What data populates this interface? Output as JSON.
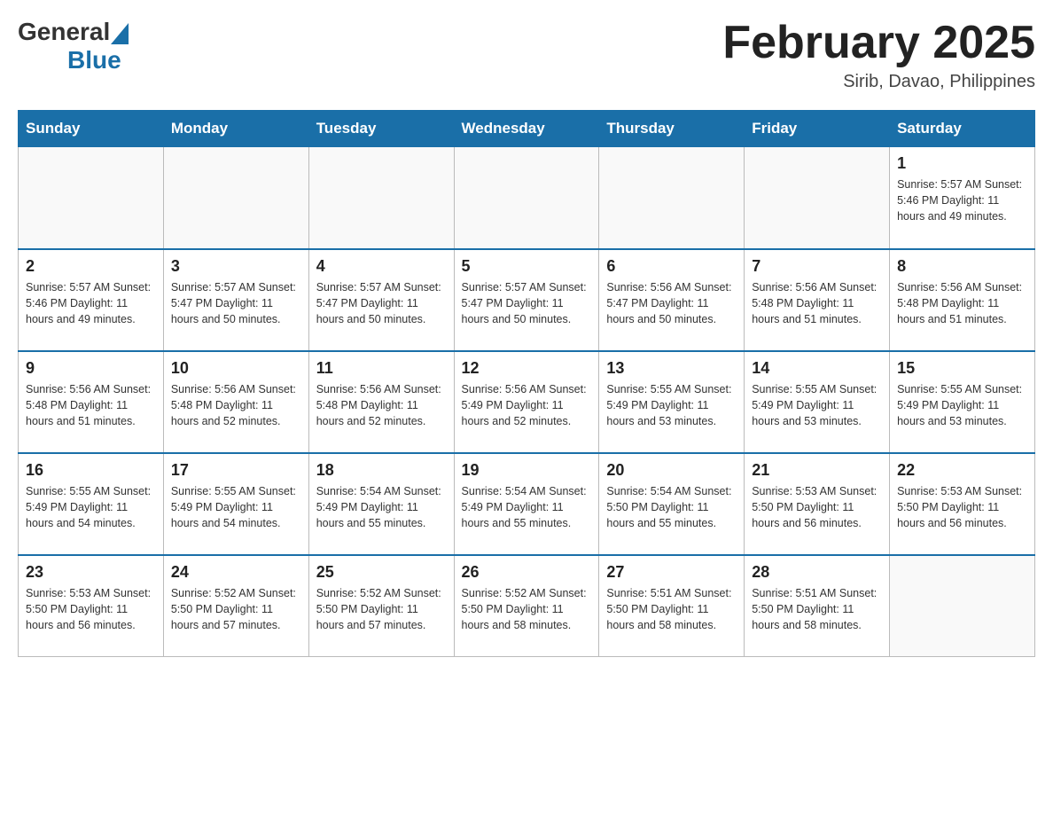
{
  "header": {
    "title": "February 2025",
    "location": "Sirib, Davao, Philippines",
    "logo": {
      "general": "General",
      "blue": "Blue"
    }
  },
  "days_of_week": [
    "Sunday",
    "Monday",
    "Tuesday",
    "Wednesday",
    "Thursday",
    "Friday",
    "Saturday"
  ],
  "weeks": [
    {
      "cells": [
        {
          "day": "",
          "info": ""
        },
        {
          "day": "",
          "info": ""
        },
        {
          "day": "",
          "info": ""
        },
        {
          "day": "",
          "info": ""
        },
        {
          "day": "",
          "info": ""
        },
        {
          "day": "",
          "info": ""
        },
        {
          "day": "1",
          "info": "Sunrise: 5:57 AM\nSunset: 5:46 PM\nDaylight: 11 hours\nand 49 minutes."
        }
      ]
    },
    {
      "cells": [
        {
          "day": "2",
          "info": "Sunrise: 5:57 AM\nSunset: 5:46 PM\nDaylight: 11 hours\nand 49 minutes."
        },
        {
          "day": "3",
          "info": "Sunrise: 5:57 AM\nSunset: 5:47 PM\nDaylight: 11 hours\nand 50 minutes."
        },
        {
          "day": "4",
          "info": "Sunrise: 5:57 AM\nSunset: 5:47 PM\nDaylight: 11 hours\nand 50 minutes."
        },
        {
          "day": "5",
          "info": "Sunrise: 5:57 AM\nSunset: 5:47 PM\nDaylight: 11 hours\nand 50 minutes."
        },
        {
          "day": "6",
          "info": "Sunrise: 5:56 AM\nSunset: 5:47 PM\nDaylight: 11 hours\nand 50 minutes."
        },
        {
          "day": "7",
          "info": "Sunrise: 5:56 AM\nSunset: 5:48 PM\nDaylight: 11 hours\nand 51 minutes."
        },
        {
          "day": "8",
          "info": "Sunrise: 5:56 AM\nSunset: 5:48 PM\nDaylight: 11 hours\nand 51 minutes."
        }
      ]
    },
    {
      "cells": [
        {
          "day": "9",
          "info": "Sunrise: 5:56 AM\nSunset: 5:48 PM\nDaylight: 11 hours\nand 51 minutes."
        },
        {
          "day": "10",
          "info": "Sunrise: 5:56 AM\nSunset: 5:48 PM\nDaylight: 11 hours\nand 52 minutes."
        },
        {
          "day": "11",
          "info": "Sunrise: 5:56 AM\nSunset: 5:48 PM\nDaylight: 11 hours\nand 52 minutes."
        },
        {
          "day": "12",
          "info": "Sunrise: 5:56 AM\nSunset: 5:49 PM\nDaylight: 11 hours\nand 52 minutes."
        },
        {
          "day": "13",
          "info": "Sunrise: 5:55 AM\nSunset: 5:49 PM\nDaylight: 11 hours\nand 53 minutes."
        },
        {
          "day": "14",
          "info": "Sunrise: 5:55 AM\nSunset: 5:49 PM\nDaylight: 11 hours\nand 53 minutes."
        },
        {
          "day": "15",
          "info": "Sunrise: 5:55 AM\nSunset: 5:49 PM\nDaylight: 11 hours\nand 53 minutes."
        }
      ]
    },
    {
      "cells": [
        {
          "day": "16",
          "info": "Sunrise: 5:55 AM\nSunset: 5:49 PM\nDaylight: 11 hours\nand 54 minutes."
        },
        {
          "day": "17",
          "info": "Sunrise: 5:55 AM\nSunset: 5:49 PM\nDaylight: 11 hours\nand 54 minutes."
        },
        {
          "day": "18",
          "info": "Sunrise: 5:54 AM\nSunset: 5:49 PM\nDaylight: 11 hours\nand 55 minutes."
        },
        {
          "day": "19",
          "info": "Sunrise: 5:54 AM\nSunset: 5:49 PM\nDaylight: 11 hours\nand 55 minutes."
        },
        {
          "day": "20",
          "info": "Sunrise: 5:54 AM\nSunset: 5:50 PM\nDaylight: 11 hours\nand 55 minutes."
        },
        {
          "day": "21",
          "info": "Sunrise: 5:53 AM\nSunset: 5:50 PM\nDaylight: 11 hours\nand 56 minutes."
        },
        {
          "day": "22",
          "info": "Sunrise: 5:53 AM\nSunset: 5:50 PM\nDaylight: 11 hours\nand 56 minutes."
        }
      ]
    },
    {
      "cells": [
        {
          "day": "23",
          "info": "Sunrise: 5:53 AM\nSunset: 5:50 PM\nDaylight: 11 hours\nand 56 minutes."
        },
        {
          "day": "24",
          "info": "Sunrise: 5:52 AM\nSunset: 5:50 PM\nDaylight: 11 hours\nand 57 minutes."
        },
        {
          "day": "25",
          "info": "Sunrise: 5:52 AM\nSunset: 5:50 PM\nDaylight: 11 hours\nand 57 minutes."
        },
        {
          "day": "26",
          "info": "Sunrise: 5:52 AM\nSunset: 5:50 PM\nDaylight: 11 hours\nand 58 minutes."
        },
        {
          "day": "27",
          "info": "Sunrise: 5:51 AM\nSunset: 5:50 PM\nDaylight: 11 hours\nand 58 minutes."
        },
        {
          "day": "28",
          "info": "Sunrise: 5:51 AM\nSunset: 5:50 PM\nDaylight: 11 hours\nand 58 minutes."
        },
        {
          "day": "",
          "info": ""
        }
      ]
    }
  ]
}
